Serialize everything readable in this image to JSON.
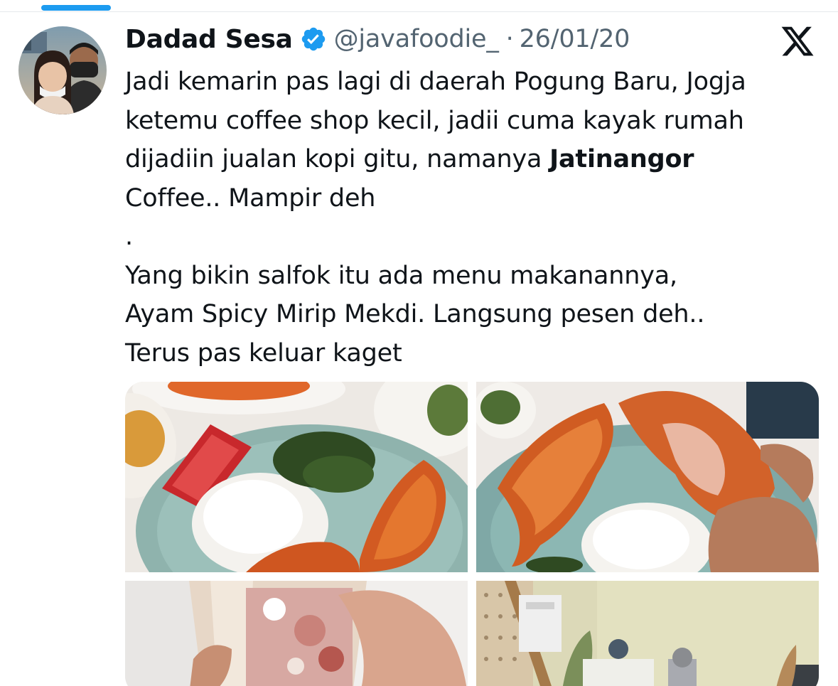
{
  "tweet": {
    "author": {
      "display_name": "Dadad Sesa",
      "handle": "@javafoodie_",
      "verified": true,
      "avatar_icon": "profile-photo"
    },
    "separator": "·",
    "date": "26/01/20",
    "brand_icon": "x-logo-icon",
    "text": {
      "line1": "Jadi kemarin pas lagi di daerah Pogung Baru, Jogja",
      "line2": "ketemu coffee shop kecil, jadii cuma kayak rumah",
      "line3_before": "dijadiin jualan kopi gitu, namanya ",
      "line3_bold": "Jatinangor",
      "line4": "Coffee.. Mampir deh",
      "line5": ".",
      "line6": "Yang bikin salfok itu ada menu makanannya,",
      "line7": "Ayam Spicy Mirip Mekdi. Langsung pesen deh..",
      "line8": "Terus pas keluar kaget"
    },
    "media": [
      {
        "alt": "fried-chicken-rice-plate-photo"
      },
      {
        "alt": "hand-holding-fried-chicken-photo"
      },
      {
        "alt": "iced-drink-cup-photo"
      },
      {
        "alt": "coffee-shop-interior-photo"
      }
    ]
  },
  "colors": {
    "accent": "#1d9bf0",
    "text_primary": "#0f1419",
    "text_secondary": "#536471",
    "divider": "#e6e9ec"
  }
}
